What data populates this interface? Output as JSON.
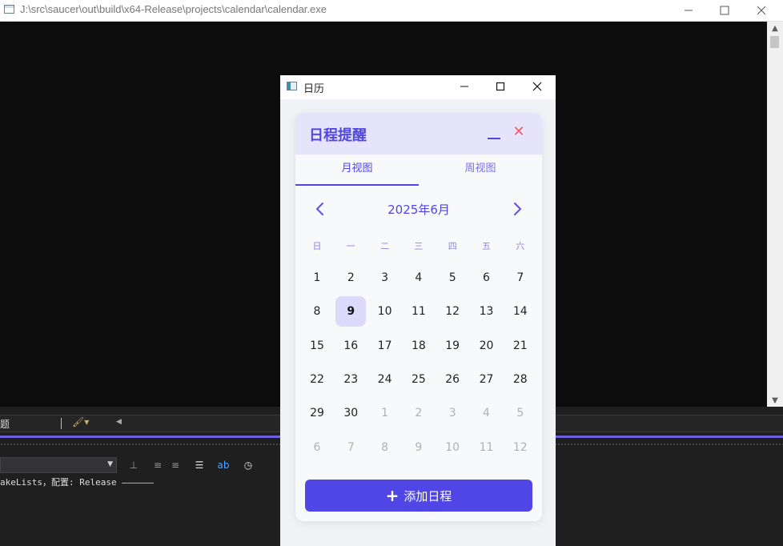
{
  "outer_window": {
    "title": "J:\\src\\saucer\\out\\build\\x64-Release\\projects\\calendar\\calendar.exe"
  },
  "bottom_panel": {
    "row_label": "题",
    "output_line": "akeLists，配置: Release ——————"
  },
  "app_window": {
    "title": "日历"
  },
  "calendar": {
    "title": "日程提醒",
    "close_glyph": "✕",
    "tabs": [
      {
        "label": "月视图",
        "active": true
      },
      {
        "label": "周视图",
        "active": false
      }
    ],
    "month_label": "2025年6月",
    "weekdays": [
      "日",
      "一",
      "二",
      "三",
      "四",
      "五",
      "六"
    ],
    "weeks": [
      [
        {
          "d": "1"
        },
        {
          "d": "2"
        },
        {
          "d": "3"
        },
        {
          "d": "4"
        },
        {
          "d": "5"
        },
        {
          "d": "6"
        },
        {
          "d": "7"
        }
      ],
      [
        {
          "d": "8"
        },
        {
          "d": "9",
          "today": true
        },
        {
          "d": "10"
        },
        {
          "d": "11"
        },
        {
          "d": "12"
        },
        {
          "d": "13"
        },
        {
          "d": "14"
        }
      ],
      [
        {
          "d": "15"
        },
        {
          "d": "16"
        },
        {
          "d": "17"
        },
        {
          "d": "18"
        },
        {
          "d": "19"
        },
        {
          "d": "20"
        },
        {
          "d": "21"
        }
      ],
      [
        {
          "d": "22"
        },
        {
          "d": "23"
        },
        {
          "d": "24"
        },
        {
          "d": "25"
        },
        {
          "d": "26"
        },
        {
          "d": "27"
        },
        {
          "d": "28"
        }
      ],
      [
        {
          "d": "29"
        },
        {
          "d": "30"
        },
        {
          "d": "1",
          "other": true
        },
        {
          "d": "2",
          "other": true
        },
        {
          "d": "3",
          "other": true
        },
        {
          "d": "4",
          "other": true
        },
        {
          "d": "5",
          "other": true
        }
      ],
      [
        {
          "d": "6",
          "other": true
        },
        {
          "d": "7",
          "other": true
        },
        {
          "d": "8",
          "other": true
        },
        {
          "d": "9",
          "other": true
        },
        {
          "d": "10",
          "other": true
        },
        {
          "d": "11",
          "other": true
        },
        {
          "d": "12",
          "other": true
        }
      ]
    ],
    "add_button_label": "添加日程"
  },
  "colors": {
    "accent": "#4f46e5",
    "header_bg": "#e6e4fa",
    "today_bg": "#dcd9fb",
    "close_red": "#f05a6a"
  }
}
